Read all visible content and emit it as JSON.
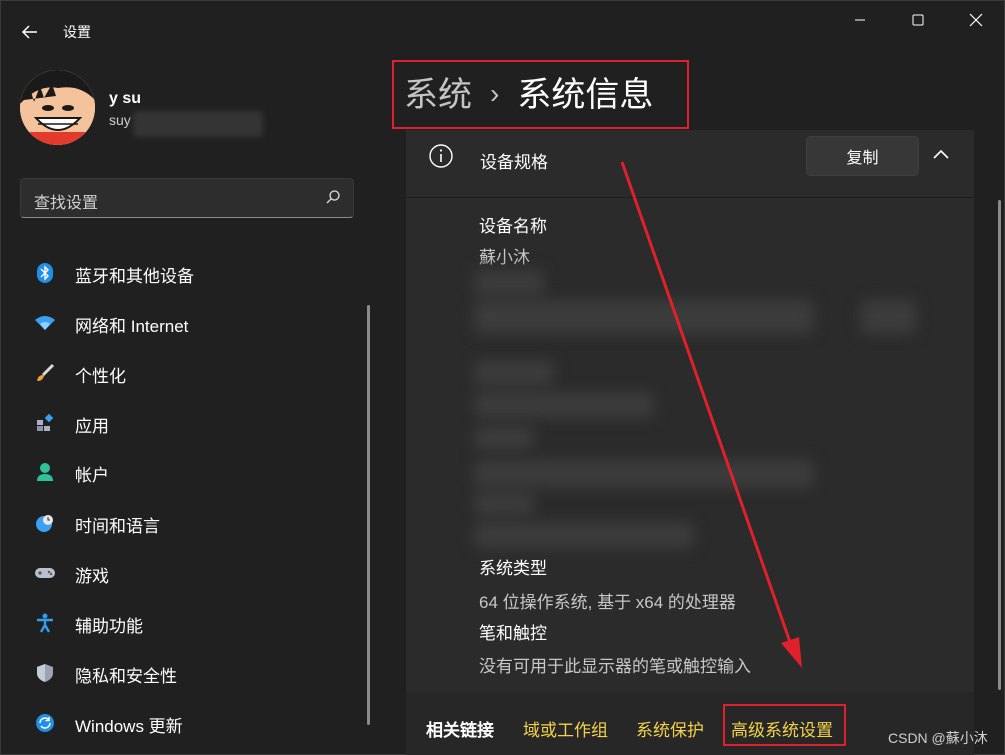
{
  "window": {
    "title": "设置"
  },
  "user": {
    "name": "y su",
    "email_visible": "suy"
  },
  "search": {
    "placeholder": "查找设置"
  },
  "nav": [
    {
      "label": "蓝牙和其他设备",
      "icon": "bluetooth-icon"
    },
    {
      "label": "网络和 Internet",
      "icon": "wifi-icon"
    },
    {
      "label": "个性化",
      "icon": "brush-icon"
    },
    {
      "label": "应用",
      "icon": "apps-icon"
    },
    {
      "label": "帐户",
      "icon": "account-icon"
    },
    {
      "label": "时间和语言",
      "icon": "clock-globe-icon"
    },
    {
      "label": "游戏",
      "icon": "gamepad-icon"
    },
    {
      "label": "辅助功能",
      "icon": "accessibility-icon"
    },
    {
      "label": "隐私和安全性",
      "icon": "shield-icon"
    },
    {
      "label": "Windows 更新",
      "icon": "update-icon"
    }
  ],
  "breadcrumb": {
    "parent": "系统",
    "separator": "›",
    "current": "系统信息"
  },
  "specs": {
    "title": "设备规格",
    "copy_label": "复制",
    "device_name_label": "设备名称",
    "device_name_value": "蘇小沐",
    "system_type_label": "系统类型",
    "system_type_value": "64 位操作系统, 基于 x64 的处理器",
    "pen_label": "笔和触控",
    "pen_value": "没有可用于此显示器的笔或触控输入"
  },
  "related": {
    "title": "相关链接",
    "links": [
      "域或工作组",
      "系统保护",
      "高级系统设置"
    ]
  },
  "watermark": "CSDN @蘇小沐",
  "colors": {
    "background": "#202020",
    "panel": "#2b2b2b",
    "link": "#f3d34a",
    "annotation": "#e0202a"
  }
}
